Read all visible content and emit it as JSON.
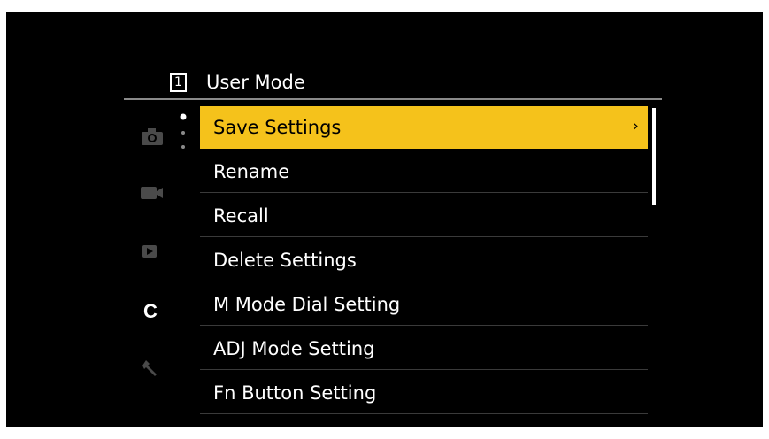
{
  "header": {
    "page_number": "1",
    "title": "User Mode"
  },
  "menu": {
    "items": [
      {
        "label": "Save Settings",
        "selected": true,
        "chevron": "›"
      },
      {
        "label": "Rename"
      },
      {
        "label": "Recall"
      },
      {
        "label": "Delete Settings"
      },
      {
        "label": "M Mode Dial Setting"
      },
      {
        "label": "ADJ Mode Setting"
      },
      {
        "label": "Fn Button Setting"
      }
    ]
  },
  "tabs": [
    {
      "icon": "camera-icon",
      "active": false
    },
    {
      "icon": "video-camera-icon",
      "active": false
    },
    {
      "icon": "playback-icon",
      "active": false
    },
    {
      "icon": "custom-c-icon",
      "label": "C",
      "active": true
    },
    {
      "icon": "wrench-icon",
      "active": false
    }
  ],
  "colors": {
    "highlight": "#f5c21b",
    "background": "#000000",
    "text": "#ffffff",
    "inactive_icon": "#4a4a4a"
  }
}
